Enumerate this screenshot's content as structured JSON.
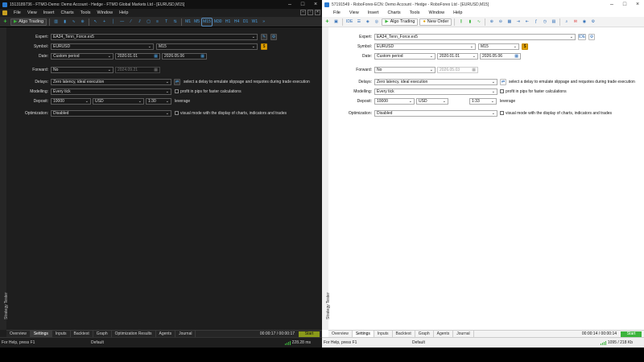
{
  "colors": {
    "mt5_dark_bg": "#1e1e1e",
    "mt5_light_bg": "#ffffff",
    "accent_blue": "#4a9fe0",
    "start_dark": "#8a9a1a",
    "start_light": "#3cb43c",
    "yellow_button": "#e0a000"
  },
  "left": {
    "title": "15131897​36 - FTMO-Demo: Demo Account - Hedge - FTMO Global Markets Ltd - [EURUSD,M15]",
    "menu": [
      "File",
      "View",
      "Insert",
      "Charts",
      "Tools",
      "Window",
      "Help"
    ],
    "algo_trading": "Algo Trading",
    "timeframes": [
      "M1",
      "M5",
      "M15",
      "M30",
      "H1",
      "H4",
      "D1",
      "W1"
    ],
    "vertical_tab": "Strategy Tester",
    "form": {
      "expert_label": "Expert:",
      "expert_value": "EA34_Tenn_Force.ex5",
      "symbol_label": "Symbol:",
      "symbol_value": "EURUSD",
      "period_value": "M15",
      "date_label": "Date:",
      "date_mode": "Custom period",
      "date_from": "2020.01.01",
      "date_to": "2026.05.06",
      "forward_label": "Forward:",
      "forward_value": "No",
      "forward_date": "2024.09.21",
      "delays_label": "Delays:",
      "delays_value": "Zero latency, ideal execution",
      "delays_hint": "select a delay to emulate slippage and requotes during trade execution",
      "modelling_label": "Modelling:",
      "modelling_value": "Every tick",
      "pips_label": "profit in pips for faster calculations",
      "deposit_label": "Deposit:",
      "deposit_value": "10000",
      "currency_value": "USD",
      "leverage_value": "1:30",
      "leverage_label": "leverage",
      "optimization_label": "Optimization:",
      "optimization_value": "Disabled",
      "visual_label": "visual mode with the display of charts, indicators and trades"
    },
    "tabs": [
      "Overview",
      "Settings",
      "Inputs",
      "Backtest",
      "Graph",
      "Optimization Results",
      "Agents",
      "Journal"
    ],
    "timer": "00:00:17 / 00:00:17",
    "start": "Start",
    "status_help": "For Help, press F1",
    "status_mode": "Default",
    "status_net": "228.28 ms"
  },
  "right": {
    "title": "5719​1549 - RoboForex-ECN: Demo Account - Hedge - RoboForex Ltd - [EURUSD,M15]",
    "menu": [
      "File",
      "View",
      "Insert",
      "Charts",
      "Tools",
      "Window",
      "Help"
    ],
    "algo_trading": "Algo Trading",
    "new_order": "New Order",
    "vertical_tab": "Strategy Tester",
    "form": {
      "expert_label": "Expert:",
      "expert_value": "EA34_Tenn_Force.ex5",
      "symbol_label": "Symbol:",
      "symbol_value": "EURUSD",
      "period_value": "M15",
      "date_label": "Date:",
      "date_mode": "Custom period",
      "date_from": "2020.01.01",
      "date_to": "2026.05.06",
      "forward_label": "Forward:",
      "forward_value": "No",
      "forward_date": "2026.05.03",
      "delays_label": "Delays:",
      "delays_value": "Zero latency, ideal execution",
      "delays_hint": "select a delay to emulate slippage and requotes during trade execution",
      "modelling_label": "Modelling:",
      "modelling_value": "Every tick",
      "pips_label": "profit in pips for faster calculations",
      "deposit_label": "Deposit:",
      "deposit_value": "10000",
      "currency_value": "USD",
      "leverage_value": "1:33",
      "leverage_label": "leverage",
      "optimization_label": "Optimization:",
      "optimization_value": "Disabled",
      "visual_label": "visual mode with the display of charts, indicators and trades"
    },
    "tabs": [
      "Overview",
      "Settings",
      "Inputs",
      "Backtest",
      "Graph",
      "Agents",
      "Journal"
    ],
    "timer": "00:00:14 / 00:00:14",
    "start": "Start",
    "status_help": "For Help, press F1",
    "status_mode": "Default",
    "status_net": "1095 / 218 Kb"
  }
}
